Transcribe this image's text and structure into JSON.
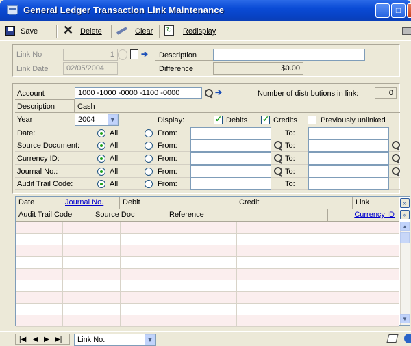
{
  "window": {
    "title": "General Ledger Transaction Link Maintenance",
    "min_glyph": "_",
    "max_glyph": "□",
    "close_glyph": "X"
  },
  "toolbar": {
    "save": "Save",
    "delete": "Delete",
    "clear": "Clear",
    "redisplay": "Redisplay"
  },
  "header": {
    "link_no_label": "Link No",
    "link_no_value": "1",
    "link_date_label": "Link Date",
    "link_date_value": "02/05/2004",
    "description_label": "Description",
    "description_value": "",
    "difference_label": "Difference",
    "difference_value": "$0.00"
  },
  "account": {
    "account_label": "Account",
    "account_value": "1000 -1000 -0000 -1100 -0000",
    "num_dist_label": "Number of distributions in link:",
    "num_dist_value": "0",
    "description_label": "Description",
    "description_value": "Cash",
    "year_label": "Year",
    "year_value": "2004",
    "display_label": "Display:",
    "debits_label": "Debits",
    "debits_checked": true,
    "credits_label": "Credits",
    "credits_checked": true,
    "prev_unlinked_label": "Previously unlinked",
    "prev_unlinked_checked": false
  },
  "filters": {
    "all_label": "All",
    "from_label": "From:",
    "to_label": "To:",
    "rows": [
      {
        "label": "Date:"
      },
      {
        "label": "Source Document:"
      },
      {
        "label": "Currency ID:"
      },
      {
        "label": "Journal No.:"
      },
      {
        "label": "Audit Trail Code:"
      }
    ]
  },
  "grid": {
    "header1": [
      "Date",
      "Journal No.",
      "Debit",
      "Credit",
      "Link"
    ],
    "header2": [
      "Audit Trail Code",
      "Source Doc",
      "Reference",
      "Currency ID"
    ]
  },
  "bottom": {
    "sort_value": "Link No."
  }
}
